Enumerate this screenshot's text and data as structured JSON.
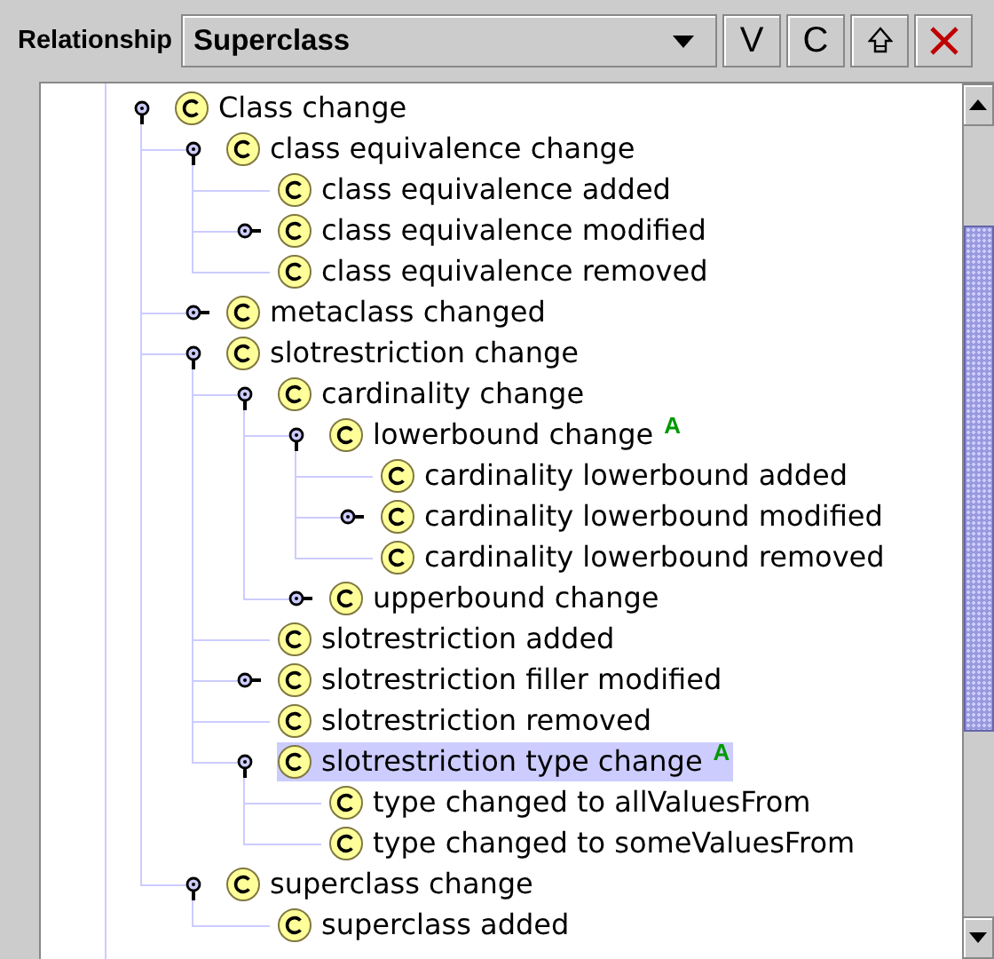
{
  "toolbar": {
    "label": "Relationship",
    "combo": {
      "value": "Superclass"
    },
    "buttons": [
      {
        "kind": "text",
        "label": "V"
      },
      {
        "kind": "text",
        "label": "C"
      },
      {
        "kind": "move-up"
      },
      {
        "kind": "delete"
      }
    ]
  },
  "tree": [
    {
      "label": "Class change",
      "expanded": true,
      "selected": false,
      "children": [
        {
          "label": "class equivalence change",
          "expanded": true,
          "selected": false,
          "children": [
            {
              "label": "class equivalence added",
              "selected": false
            },
            {
              "label": "class equivalence modified",
              "expanded": false,
              "selected": false
            },
            {
              "label": "class equivalence removed",
              "selected": false
            }
          ]
        },
        {
          "label": "metaclass changed",
          "expanded": false,
          "selected": false
        },
        {
          "label": "slotrestriction change",
          "expanded": true,
          "selected": false,
          "children": [
            {
              "label": "cardinality change",
              "expanded": true,
              "selected": false,
              "children": [
                {
                  "label": "lowerbound change",
                  "badge": "A",
                  "expanded": true,
                  "selected": false,
                  "children": [
                    {
                      "label": "cardinality lowerbound added",
                      "selected": false
                    },
                    {
                      "label": "cardinality lowerbound modified",
                      "expanded": false,
                      "selected": false
                    },
                    {
                      "label": "cardinality lowerbound removed",
                      "selected": false
                    }
                  ]
                },
                {
                  "label": "upperbound change",
                  "expanded": false,
                  "selected": false
                }
              ]
            },
            {
              "label": "slotrestriction added",
              "selected": false
            },
            {
              "label": "slotrestriction filler modified",
              "expanded": false,
              "selected": false
            },
            {
              "label": "slotrestriction removed",
              "selected": false
            },
            {
              "label": "slotrestriction type change",
              "badge": "A",
              "expanded": true,
              "selected": true,
              "children": [
                {
                  "label": "type changed to allValuesFrom",
                  "selected": false
                },
                {
                  "label": "type changed to someValuesFrom",
                  "selected": false
                }
              ]
            }
          ]
        },
        {
          "label": "superclass change",
          "expanded": true,
          "selected": false,
          "children": [
            {
              "label": "superclass added",
              "selected": false
            }
          ]
        }
      ]
    }
  ]
}
